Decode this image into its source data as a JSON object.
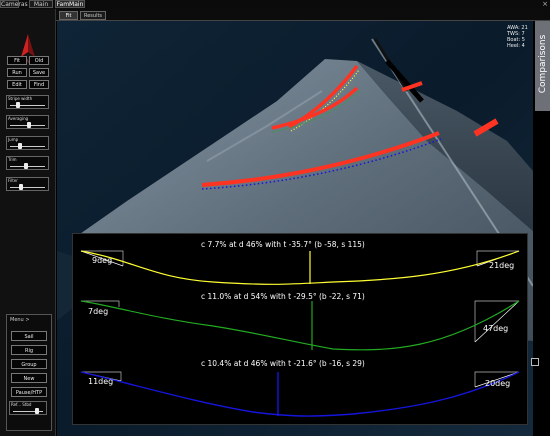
{
  "top_tabs": [
    "Cameras",
    "Main",
    "FamMain"
  ],
  "window_close_glyph": "×",
  "logo": {
    "text": "SPANS",
    "icon": "sail-icon",
    "color": "#cc2222"
  },
  "toolbar_buttons": [
    "Fit",
    "Old",
    "Run",
    "Save",
    "Edit",
    "Find"
  ],
  "sliders": [
    {
      "label": "Stripe width",
      "value": 0.2
    },
    {
      "label": "Averaging",
      "value": 0.55
    },
    {
      "label": "Jump",
      "value": 0.25
    },
    {
      "label": "Trim",
      "value": 0.45
    },
    {
      "label": "Filter",
      "value": 0.3
    }
  ],
  "menu": {
    "title": "Menu >",
    "buttons": [
      "Sail",
      "Rig",
      "Group",
      "New",
      "Pause/HTP"
    ],
    "slider_label": "Ref... Stbd",
    "slider_value": 0.85
  },
  "sub_tabs": [
    "Fit",
    "Results"
  ],
  "readout": [
    "AWA: 21",
    "TWS: 7",
    "Boat: 5",
    "Heel: 4"
  ],
  "comparisons_label": "Comparisons",
  "colors": {
    "stripe_top": "#ffff33",
    "stripe_mid": "#22aa22",
    "stripe_bottom": "#1515dd",
    "detected_stripe": "#ff3322",
    "accent_red": "#cc2222"
  },
  "sections": [
    {
      "id": "top",
      "color": "#ffff33",
      "summary": "c 7.7% at d 46% with t -35.7° (b -58, s 115)",
      "left_angle": "9deg",
      "right_angle": "21deg"
    },
    {
      "id": "mid",
      "color": "#22aa22",
      "summary": "c 11.0% at d 54% with t -29.5° (b -22, s 71)",
      "left_angle": "7deg",
      "right_angle": "47deg"
    },
    {
      "id": "bottom",
      "color": "#1515dd",
      "summary": "c 10.4% at d 46% with t -21.6° (b -16, s 29)",
      "left_angle": "11deg",
      "right_angle": "20deg"
    }
  ]
}
